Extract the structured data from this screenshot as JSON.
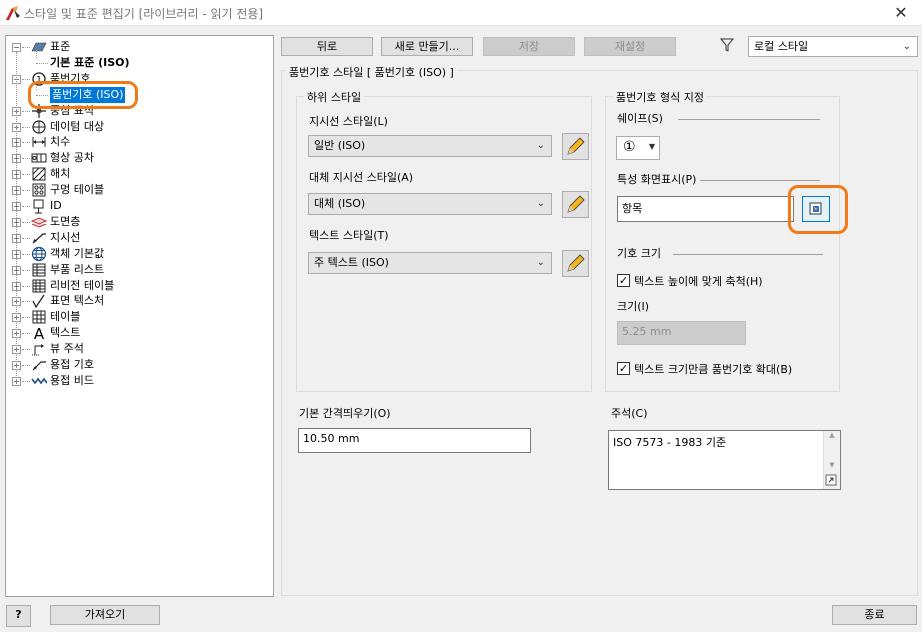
{
  "window": {
    "title": "스타일 및 표준 편집기 [라이브러리 - 읽기 전용]",
    "close": "✕"
  },
  "tree": {
    "items": [
      {
        "label": "표준",
        "icon": "standard-icon",
        "toggle": "−"
      },
      {
        "label": "기본 표준 (ISO)",
        "bold": true
      },
      {
        "label": "품번기호",
        "icon": "balloon-icon",
        "toggle": "−"
      },
      {
        "label": "품번기호 (ISO)",
        "selected": true
      },
      {
        "label": "중심 표식",
        "icon": "center-mark-icon",
        "toggle": "+"
      },
      {
        "label": "데이텀 대상",
        "icon": "datum-target-icon",
        "toggle": "+"
      },
      {
        "label": "치수",
        "icon": "dimension-icon",
        "toggle": "+"
      },
      {
        "label": "형상 공차",
        "icon": "feature-control-icon",
        "toggle": "+"
      },
      {
        "label": "해치",
        "icon": "hatch-icon",
        "toggle": "+"
      },
      {
        "label": "구멍 테이블",
        "icon": "hole-table-icon",
        "toggle": "+"
      },
      {
        "label": "ID",
        "icon": "id-icon",
        "toggle": "+"
      },
      {
        "label": "도면층",
        "icon": "layer-icon",
        "toggle": "+"
      },
      {
        "label": "지시선",
        "icon": "leader-icon",
        "toggle": "+"
      },
      {
        "label": "객체 기본값",
        "icon": "globe-icon",
        "toggle": "+"
      },
      {
        "label": "부품 리스트",
        "icon": "parts-list-icon",
        "toggle": "+"
      },
      {
        "label": "리비전 테이블",
        "icon": "revision-table-icon",
        "toggle": "+"
      },
      {
        "label": "표면 텍스처",
        "icon": "surface-texture-icon",
        "toggle": "+"
      },
      {
        "label": "테이블",
        "icon": "table-icon",
        "toggle": "+"
      },
      {
        "label": "텍스트",
        "icon": "text-icon",
        "toggle": "+"
      },
      {
        "label": "뷰 주석",
        "icon": "view-annotation-icon",
        "toggle": "+"
      },
      {
        "label": "용접 기호",
        "icon": "weld-symbol-icon",
        "toggle": "+"
      },
      {
        "label": "용접 비드",
        "icon": "weld-bead-icon",
        "toggle": "+"
      }
    ]
  },
  "toolbar": {
    "back": "뒤로",
    "new": "새로 만들기...",
    "save": "저장",
    "reset": "재설정",
    "filter_value": "로컬 스타일"
  },
  "panel": {
    "title": "품번기호 스타일 [ 품번기호 (ISO) ]",
    "sub_styles": {
      "legend": "하위 스타일",
      "leader_label": "지시선 스타일(L)",
      "leader_value": "일반 (ISO)",
      "alt_leader_label": "대체 지시선 스타일(A)",
      "alt_leader_value": "대체 (ISO)",
      "text_label": "텍스트 스타일(T)",
      "text_value": "주 텍스트 (ISO)"
    },
    "format": {
      "legend": "품번기호 형식 지정",
      "shape_label": "쉐이프(S)",
      "shape_value": "①",
      "prop_label": "특성 화면표시(P)",
      "prop_value": "항목",
      "size_legend": "기호 크기",
      "scale_label": "텍스트 높이에 맞게 축척(H)",
      "size_label": "크기(I)",
      "size_value": "5.25 mm",
      "enlarge_label": "텍스트 크기만큼 품번기호 확대(B)"
    },
    "spacing_label": "기본 간격띄우기(O)",
    "spacing_value": "10.50 mm",
    "notes_label": "주석(C)",
    "notes_value": "ISO 7573 - 1983 기준"
  },
  "footer": {
    "help": "?",
    "import": "가져오기",
    "done": "종료"
  },
  "colors": {
    "accent": "#0078d7",
    "highlight": "#f07a1a"
  }
}
